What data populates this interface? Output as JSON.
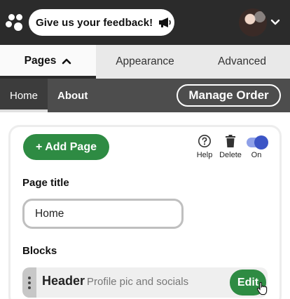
{
  "topbar": {
    "feedback_label": "Give us your feedback!",
    "icons": [
      "logo-icon",
      "megaphone-icon",
      "avatar",
      "chevron-down-icon"
    ]
  },
  "tabs": [
    {
      "label": "Pages",
      "active": true
    },
    {
      "label": "Appearance",
      "active": false
    },
    {
      "label": "Advanced",
      "active": false
    }
  ],
  "subnav": {
    "items": [
      {
        "label": "Home",
        "active": true
      },
      {
        "label": "About",
        "active": false
      }
    ],
    "manage_label": "Manage Order"
  },
  "page_card": {
    "add_label": "+ Add Page",
    "tools": {
      "help": "Help",
      "delete": "Delete",
      "on": "On"
    },
    "page_title_label": "Page title",
    "page_title_value": "Home",
    "blocks_label": "Blocks",
    "blocks": [
      {
        "name": "Header",
        "description": "Profile pic and socials",
        "edit_label": "Edit"
      }
    ]
  },
  "colors": {
    "topbar": "#2b2b2b",
    "subnav": "#4d4d4d",
    "accent_green": "#2e8b43",
    "toggle_blue": "#3c55c6"
  }
}
